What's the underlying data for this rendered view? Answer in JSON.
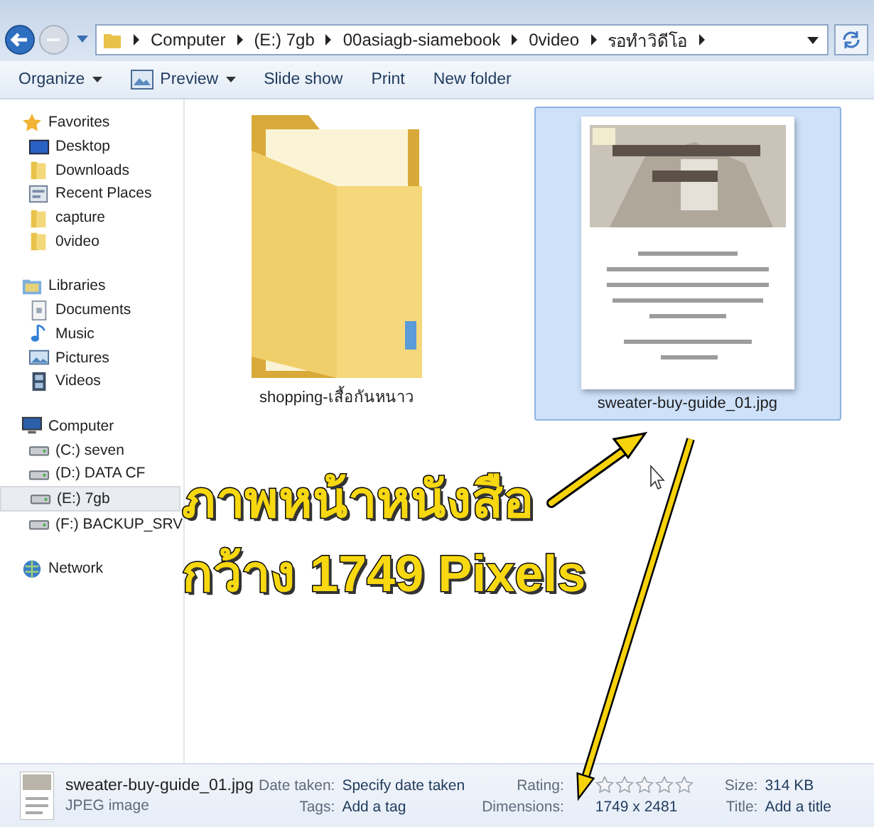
{
  "address_bar": {
    "path": [
      "Computer",
      "(E:) 7gb",
      "00asiagb-siamebook",
      "0video",
      "รอทำวิดีโอ"
    ]
  },
  "toolbar": [
    {
      "label": "Organize",
      "dropdown": true,
      "kind": "plain"
    },
    {
      "label": "Preview",
      "dropdown": true,
      "kind": "preview"
    },
    {
      "label": "Slide show",
      "dropdown": false,
      "kind": "plain"
    },
    {
      "label": "Print",
      "dropdown": false,
      "kind": "plain"
    },
    {
      "label": "New folder",
      "dropdown": false,
      "kind": "plain"
    }
  ],
  "sidebar": {
    "groups": [
      {
        "label": "Favorites",
        "kind": "star",
        "items": [
          {
            "label": "Desktop",
            "kind": "monitor",
            "selected": false
          },
          {
            "label": "Downloads",
            "kind": "download",
            "selected": false
          },
          {
            "label": "Recent Places",
            "kind": "recent",
            "selected": false
          },
          {
            "label": "capture",
            "kind": "folder",
            "selected": false
          },
          {
            "label": "0video",
            "kind": "folder",
            "selected": false
          }
        ]
      },
      {
        "label": "Libraries",
        "kind": "library",
        "items": [
          {
            "label": "Documents",
            "kind": "document",
            "selected": false
          },
          {
            "label": "Music",
            "kind": "music",
            "selected": false
          },
          {
            "label": "Pictures",
            "selected": false
          },
          {
            "label": "Videos",
            "kind": "film",
            "selected": false
          }
        ]
      },
      {
        "label": "Computer",
        "kind": "computer",
        "items": [
          {
            "label": "(C:) seven",
            "kind": "drive",
            "selected": false
          },
          {
            "label": "(D:) DATA CF",
            "kind": "drive",
            "selected": false
          },
          {
            "label": "(E:) 7gb",
            "kind": "drive",
            "selected": true
          },
          {
            "label": "(F:) BACKUP_SRV",
            "kind": "drive",
            "selected": false
          }
        ]
      },
      {
        "label": "Network",
        "kind": "network"
      }
    ]
  },
  "files": [
    {
      "name": "shopping-เสื้อกันหนาว",
      "kind": "folder",
      "selected": false
    },
    {
      "name": "sweater-buy-guide_01.jpg",
      "kind": "picture",
      "selected": true
    }
  ],
  "annotation": {
    "lines": [
      "ภาพหน้าหนังสือ",
      "กว้าง 1749 Pixels"
    ]
  },
  "details": {
    "name": "sweater-buy-guide_01.jpg",
    "type": "JPEG image",
    "columns": [
      [
        {
          "label": "Date taken:",
          "value": "Specify date taken"
        },
        {
          "label": "Tags:",
          "value": "Add a tag"
        }
      ],
      [
        {
          "label": "Rating:",
          "kind": "rating",
          "stars": 0
        },
        {
          "label": "Dimensions:",
          "value": "1749 x 2481"
        }
      ],
      [
        {
          "label": "Size:",
          "value": "314 KB"
        },
        {
          "label": "Title:",
          "value": "Add a title"
        }
      ]
    ]
  }
}
